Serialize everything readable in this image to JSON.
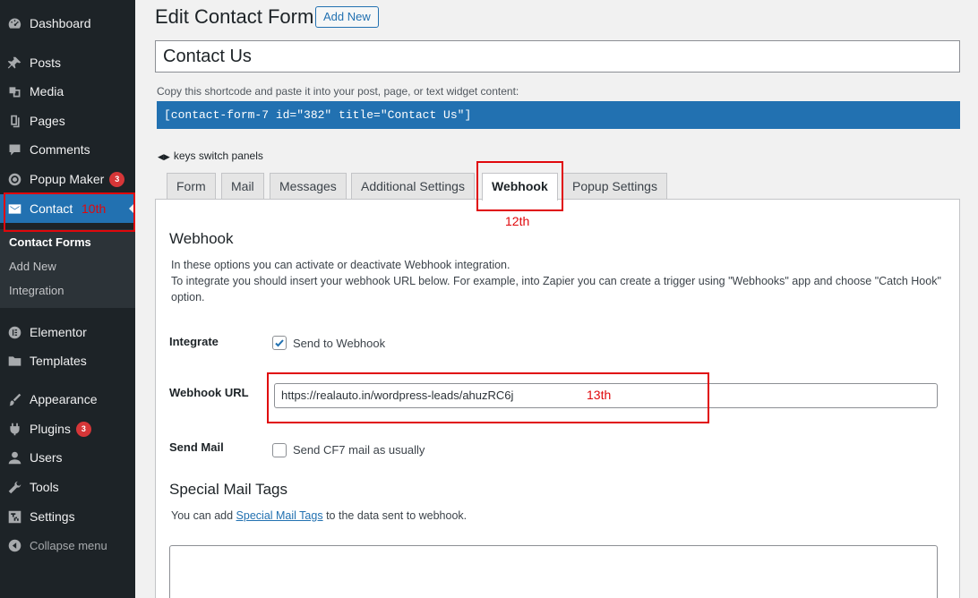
{
  "sidebar": {
    "items": [
      {
        "label": "Dashboard",
        "icon": "dashboard-icon"
      },
      {
        "label": "Posts",
        "icon": "pin-icon"
      },
      {
        "label": "Media",
        "icon": "media-icon"
      },
      {
        "label": "Pages",
        "icon": "pages-icon"
      },
      {
        "label": "Comments",
        "icon": "comments-icon"
      },
      {
        "label": "Popup Maker",
        "icon": "popup-icon",
        "badge": "3"
      },
      {
        "label": "Contact",
        "icon": "envelope-icon"
      },
      {
        "label": "Elementor",
        "icon": "elementor-icon"
      },
      {
        "label": "Templates",
        "icon": "folder-icon"
      },
      {
        "label": "Appearance",
        "icon": "brush-icon"
      },
      {
        "label": "Plugins",
        "icon": "plugin-icon",
        "badge": "3"
      },
      {
        "label": "Users",
        "icon": "user-icon"
      },
      {
        "label": "Tools",
        "icon": "wrench-icon"
      },
      {
        "label": "Settings",
        "icon": "settings-icon"
      },
      {
        "label": "Collapse menu",
        "icon": "collapse-icon"
      }
    ],
    "submenu": [
      "Contact Forms",
      "Add New",
      "Integration"
    ]
  },
  "annotations": {
    "contact": "10th",
    "tab": "12th",
    "url": "13th"
  },
  "header": {
    "title": "Edit Contact Form",
    "add_new": "Add New"
  },
  "form": {
    "title_value": "Contact Us",
    "shortcode_hint": "Copy this shortcode and paste it into your post, page, or text widget content:",
    "shortcode": "[contact-form-7 id=\"382\" title=\"Contact Us\"]",
    "keys_hint": "keys switch panels"
  },
  "tabs": [
    "Form",
    "Mail",
    "Messages",
    "Additional Settings",
    "Webhook",
    "Popup Settings"
  ],
  "panel": {
    "heading": "Webhook",
    "desc1": "In these options you can activate or deactivate Webhook integration.",
    "desc2": "To integrate you should insert your webhook URL below. For example, into Zapier you can create a trigger using \"Webhooks\" app and choose \"Catch Hook\" option.",
    "integrate_label": "Integrate",
    "integrate_cb": "Send to Webhook",
    "integrate_checked": true,
    "url_label": "Webhook URL",
    "url_value": "https://realauto.in/wordpress-leads/ahuzRC6j",
    "sendmail_label": "Send Mail",
    "sendmail_cb": "Send CF7 mail as usually",
    "sendmail_checked": false,
    "tags_heading": "Special Mail Tags",
    "tags_pre": "You can add",
    "tags_link": "Special Mail Tags",
    "tags_post": "to the data sent to webhook."
  },
  "colors": {
    "admin_bar": "#1d2327",
    "accent": "#2271b1",
    "annotation": "#e0080c",
    "badge": "#d63638"
  }
}
